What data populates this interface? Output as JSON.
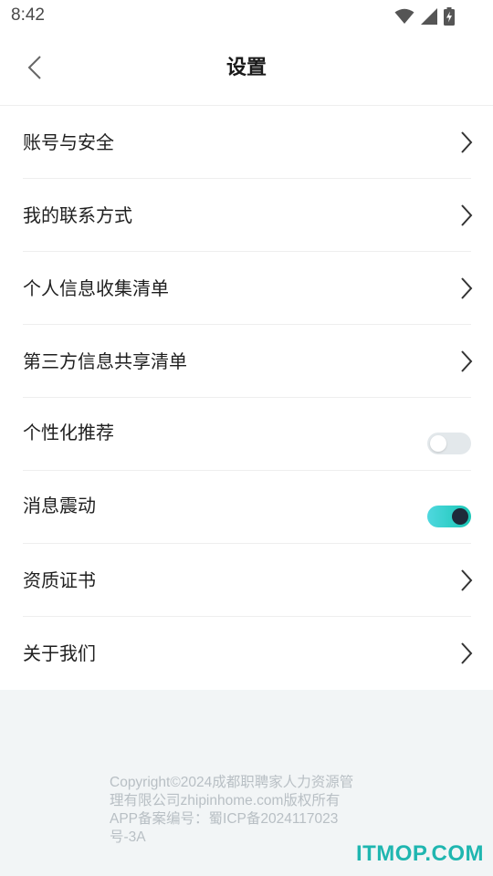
{
  "status_bar": {
    "time": "8:42",
    "icons": [
      "wifi-icon",
      "signal-icon",
      "battery-charging-icon"
    ]
  },
  "header": {
    "title": "设置",
    "back_icon": "chevron-left-icon"
  },
  "settings": {
    "items": [
      {
        "label": "账号与安全",
        "control": "chevron"
      },
      {
        "label": "我的联系方式",
        "control": "chevron"
      },
      {
        "label": "个人信息收集清单",
        "control": "chevron"
      },
      {
        "label": "第三方信息共享清单",
        "control": "chevron"
      },
      {
        "label": "个性化推荐",
        "control": "toggle",
        "toggle_on": false
      },
      {
        "label": "消息震动",
        "control": "toggle",
        "toggle_on": true
      },
      {
        "label": "资质证书",
        "control": "chevron"
      },
      {
        "label": "关于我们",
        "control": "chevron"
      }
    ]
  },
  "footer": {
    "copyright_line1": "Copyright©2024成都职聘家人力资源管",
    "copyright_line2": "理有限公司zhipinhome.com版权所有",
    "copyright_line3": "APP备案编号：蜀ICP备2024117023",
    "copyright_line4": "号-3A"
  },
  "watermark": "ITMOP.COM",
  "colors": {
    "toggle_on_start": "#4fd8df",
    "toggle_on_end": "#19c6b5",
    "toggle_off": "#e3e8eb",
    "page_background": "#f2f5f6",
    "watermark": "#1fb6b0"
  }
}
